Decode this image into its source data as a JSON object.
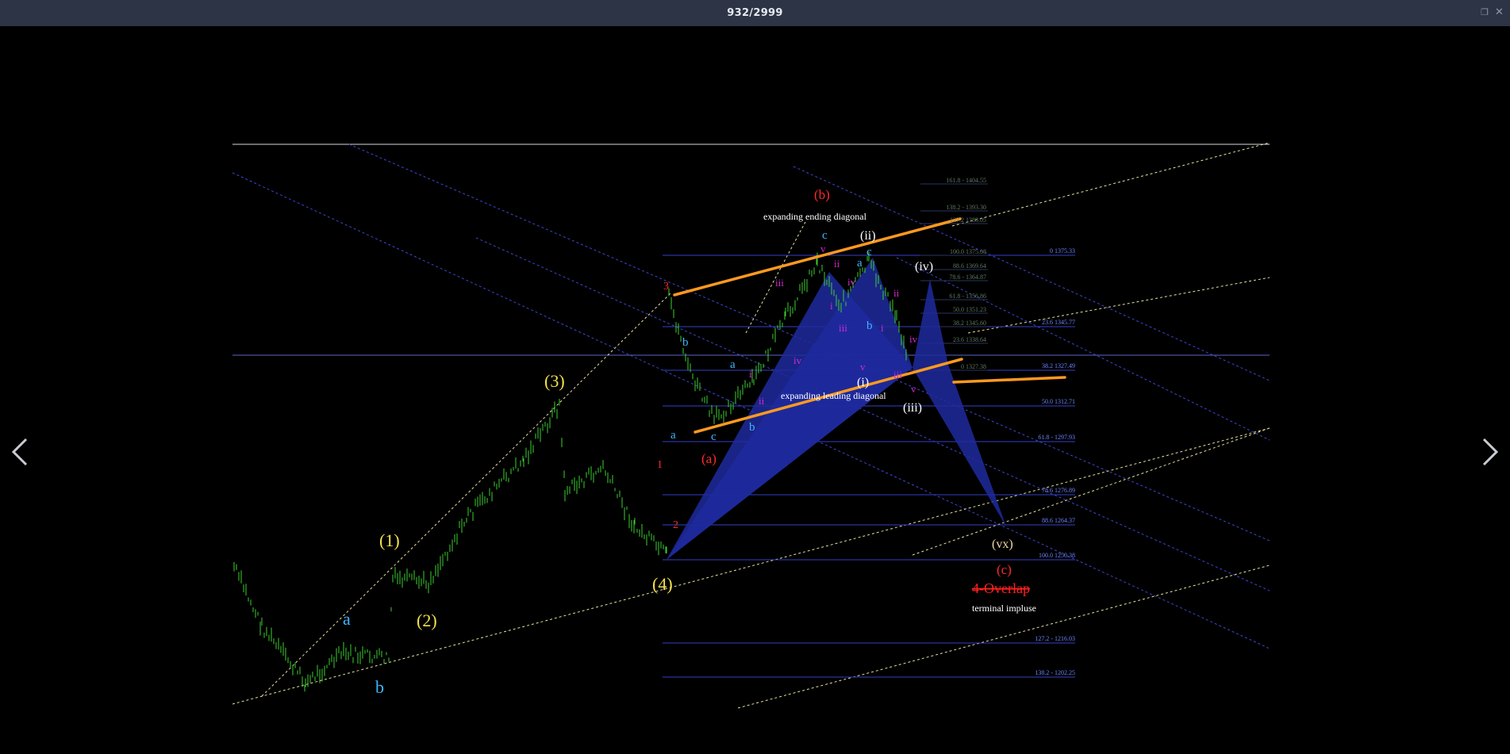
{
  "window": {
    "title": "932/2999",
    "minimize_icon": "window-restore-icon",
    "close_icon": "close-icon"
  },
  "nav": {
    "prev_icon": "chevron-left-icon",
    "next_icon": "chevron-right-icon"
  },
  "colors": {
    "titlebar": "#2c3446",
    "background": "#000000",
    "candles": "#3ccf2e",
    "trendlines": "#ff9a1f",
    "pattern_fill": "#1f2a9e",
    "fib_lines": "#3d4ad6"
  },
  "labels": {
    "primary_1": "(1)",
    "primary_2": "(2)",
    "primary_3": "(3)",
    "primary_4": "(4)",
    "a_low": "a",
    "b_low": "b",
    "red_1": "1",
    "red_2": "2",
    "red_3": "3",
    "red_a": "(a)",
    "red_b": "(b)",
    "red_c": "(c)",
    "wave_a1": "a",
    "wave_b1": "b",
    "wave_c1": "c",
    "wave_a2": "a",
    "wave_b2": "b",
    "wave_c2": "c",
    "wave_a3": "a",
    "wave_b3": "b",
    "wave_c3": "c",
    "sub_i1": "i",
    "sub_ii1": "ii",
    "sub_iii1": "iii",
    "sub_iv1": "iv",
    "sub_v1": "v",
    "sub_i2": "i",
    "sub_ii2": "ii",
    "sub_iii2": "iii",
    "sub_iv2": "iv",
    "sub_v2": "v",
    "sub_i3": "i",
    "sub_ii3": "ii",
    "sub_iii3": "iii",
    "sub_iv3": "iv",
    "sub_v3": "v",
    "minor_i": "(i)",
    "minor_ii": "(ii)",
    "minor_iii": "(iii)",
    "minor_iv": "(iv)",
    "minor_vx": "(vx)",
    "expanding_ending": "expanding ending diagonal",
    "expanding_leading": "expanding leading diagonal",
    "overlap": "4-Overlap",
    "terminal": "terminal impluse"
  },
  "fib_right": [
    "0 1375.33",
    "23.6 1345.77",
    "38.2 1327.49",
    "50.0 1312.71",
    "61.8 - 1297.93",
    "78.6 1276.89",
    "88.6 1264.37",
    "100.0 1250.38",
    "127.2 - 1216.03",
    "138.2 - 1202.25"
  ],
  "fib_small": [
    "161.8 - 1404.55",
    "138.2 - 1393.30",
    "127.2 1388.05",
    "100.0 1375.08",
    "88.6 1369.64",
    "78.6 - 1364.87",
    "61.8 - 1356.86",
    "50.0 1351.23",
    "38.2 1345.60",
    "23.6 1338.64",
    "0 1327.38"
  ]
}
